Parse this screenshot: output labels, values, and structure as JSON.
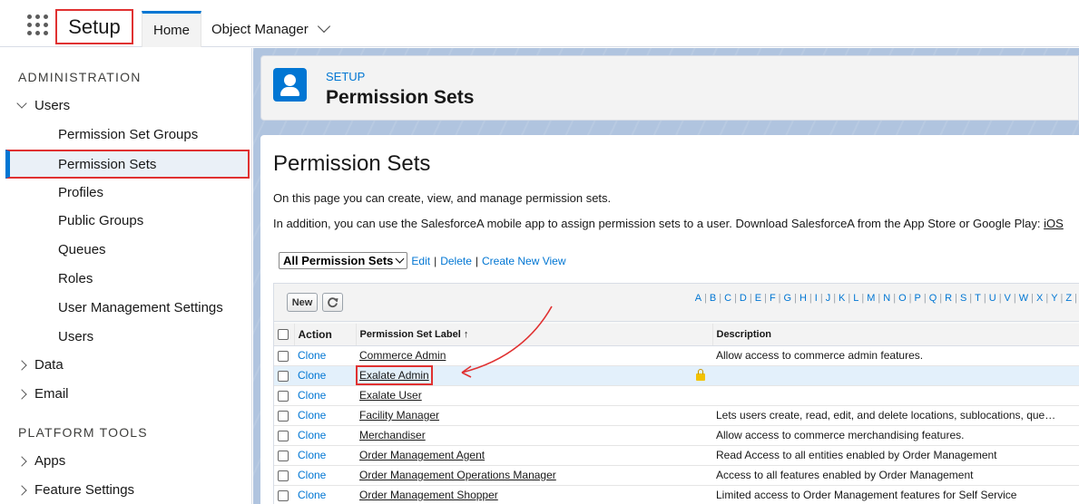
{
  "topbar": {
    "app_title": "Setup",
    "tabs": [
      {
        "label": "Home"
      },
      {
        "label": "Object Manager"
      }
    ]
  },
  "sidebar": {
    "admin_heading": "ADMINISTRATION",
    "users_label": "Users",
    "user_items": [
      {
        "label": "Permission Set Groups"
      },
      {
        "label": "Permission Sets"
      },
      {
        "label": "Profiles"
      },
      {
        "label": "Public Groups"
      },
      {
        "label": "Queues"
      },
      {
        "label": "Roles"
      },
      {
        "label": "User Management Settings"
      },
      {
        "label": "Users"
      }
    ],
    "data_label": "Data",
    "email_label": "Email",
    "platform_heading": "PLATFORM TOOLS",
    "apps_label": "Apps",
    "feature_settings_label": "Feature Settings"
  },
  "header": {
    "eyebrow": "SETUP",
    "title": "Permission Sets"
  },
  "content": {
    "title": "Permission Sets",
    "description": "On this page you can create, view, and manage permission sets.",
    "description2": "In addition, you can use the SalesforceA mobile app to assign permission sets to a user. Download SalesforceA from the App Store or Google Play: ",
    "ios_link": "iOS",
    "view_select": "All Permission Sets",
    "view_links": {
      "edit": "Edit",
      "delete": "Delete",
      "create": "Create New View"
    },
    "new_button": "New",
    "alphabet": [
      "A",
      "B",
      "C",
      "D",
      "E",
      "F",
      "G",
      "H",
      "I",
      "J",
      "K",
      "L",
      "M",
      "N",
      "O",
      "P",
      "Q",
      "R",
      "S",
      "T",
      "U",
      "V",
      "W",
      "X",
      "Y",
      "Z"
    ]
  },
  "table": {
    "columns": {
      "action": "Action",
      "label": "Permission Set Label ↑",
      "description": "Description"
    },
    "rows": [
      {
        "action": "Clone",
        "label": "Commerce Admin",
        "description": "Allow access to commerce admin features."
      },
      {
        "action": "Clone",
        "label": "Exalate Admin",
        "description": ""
      },
      {
        "action": "Clone",
        "label": "Exalate User",
        "description": ""
      },
      {
        "action": "Clone",
        "label": "Facility Manager",
        "description": "Lets users create, read, edit, and delete locations, sublocations, que…"
      },
      {
        "action": "Clone",
        "label": "Merchandiser",
        "description": "Allow access to commerce merchandising features."
      },
      {
        "action": "Clone",
        "label": "Order Management Agent",
        "description": "Read Access to all entities enabled by Order Management"
      },
      {
        "action": "Clone",
        "label": "Order Management Operations Manager",
        "description": "Access to all features enabled by Order Management"
      },
      {
        "action": "Clone",
        "label": "Order Management Shopper",
        "description": "Limited access to Order Management features for Self Service"
      }
    ]
  },
  "colors": {
    "accent": "#0176d3",
    "highlight_box": "#e03131"
  }
}
